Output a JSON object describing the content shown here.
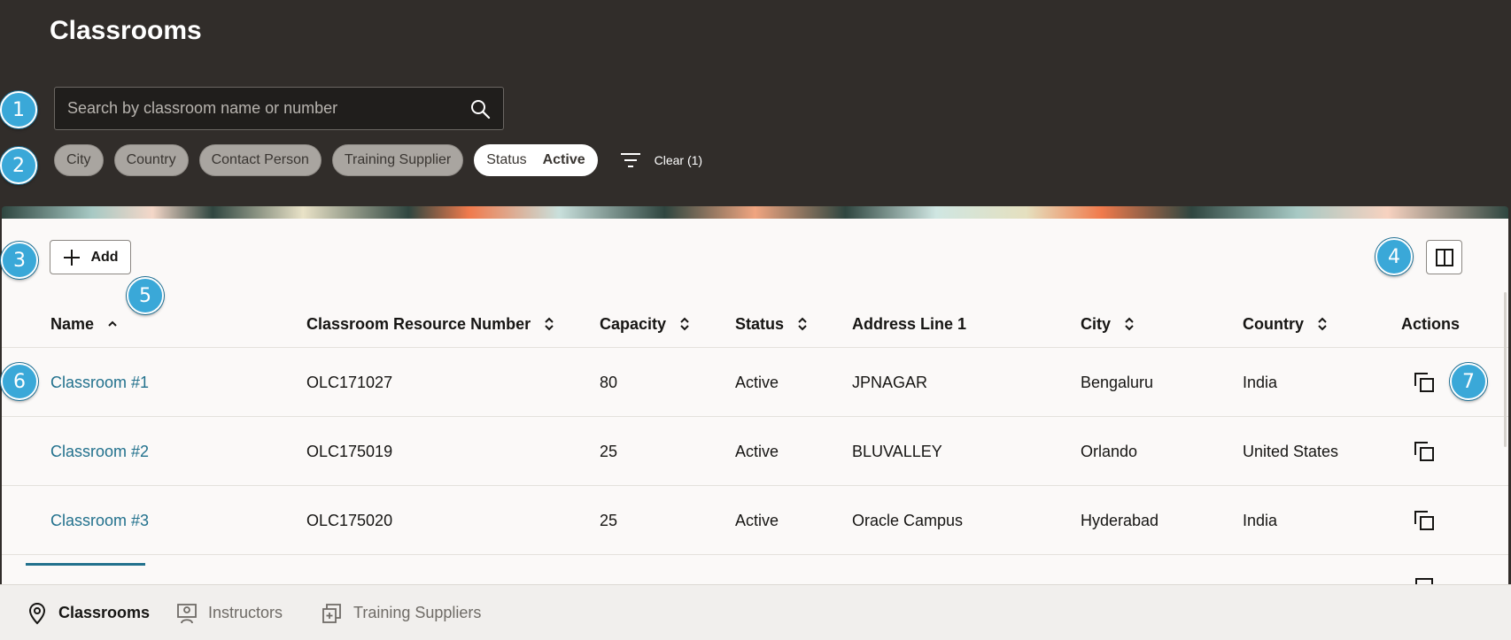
{
  "page": {
    "title": "Classrooms"
  },
  "search": {
    "placeholder": "Search by classroom name or number"
  },
  "filters": {
    "chips": [
      "City",
      "Country",
      "Contact Person",
      "Training Supplier"
    ],
    "status_label": "Status",
    "status_value": "Active",
    "clear_label": "Clear (1)"
  },
  "toolbar": {
    "add_label": "Add"
  },
  "table": {
    "columns": [
      "Name",
      "Classroom Resource Number",
      "Capacity",
      "Status",
      "Address Line 1",
      "City",
      "Country",
      "Actions"
    ],
    "rows": [
      {
        "name": "Classroom #1",
        "number": "OLC171027",
        "capacity": "80",
        "status": "Active",
        "address": "JPNAGAR",
        "city": "Bengaluru",
        "country": "India"
      },
      {
        "name": "Classroom #2",
        "number": "OLC175019",
        "capacity": "25",
        "status": "Active",
        "address": "BLUVALLEY",
        "city": "Orlando",
        "country": "United States"
      },
      {
        "name": "Classroom #3",
        "number": "OLC175020",
        "capacity": "25",
        "status": "Active",
        "address": "Oracle Campus",
        "city": "Hyderabad",
        "country": "India"
      }
    ]
  },
  "nav": {
    "items": [
      "Classrooms",
      "Instructors",
      "Training Suppliers"
    ]
  },
  "callouts": [
    "1",
    "2",
    "3",
    "4",
    "5",
    "6",
    "7"
  ],
  "colors": {
    "header_bg": "#312d2a",
    "link": "#22718d",
    "callout": "#3aa8d8"
  }
}
